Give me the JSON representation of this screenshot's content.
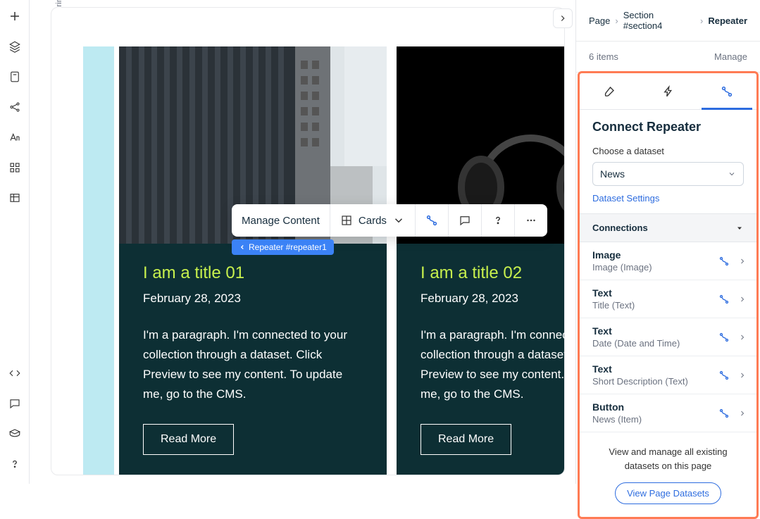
{
  "breakpoint_label": "Desktop (Primary)",
  "breadcrumb": {
    "page": "Page",
    "section": "Section #section4",
    "current": "Repeater"
  },
  "items_count": "6 items",
  "manage_label": "Manage",
  "panel": {
    "title": "Connect Repeater",
    "choose_label": "Choose a dataset",
    "dataset_selected": "News",
    "settings_link": "Dataset Settings",
    "connections_header": "Connections",
    "footer_text": "View and manage all existing datasets on this page",
    "footer_btn": "View Page Datasets"
  },
  "connections": [
    {
      "type": "Image",
      "field": "Image (Image)"
    },
    {
      "type": "Text",
      "field": "Title (Text)"
    },
    {
      "type": "Text",
      "field": "Date (Date and Time)"
    },
    {
      "type": "Text",
      "field": "Short Description (Text)"
    },
    {
      "type": "Button",
      "field": "News (Item)"
    }
  ],
  "toolbar": {
    "manage_content": "Manage Content",
    "layout_label": "Cards"
  },
  "repeater_tag": "Repeater #repeater1",
  "cards": [
    {
      "title": "I am a title 01",
      "date": "February 28, 2023",
      "desc": "I'm a paragraph. I'm connected to your collection through a dataset. Click Preview to see my content. To update me, go to the CMS.",
      "btn": "Read More"
    },
    {
      "title": "I am a title 02",
      "date": "February 28, 2023",
      "desc": "I'm a paragraph. I'm connected to your collection through a dataset. Click Preview to see my content. To update me, go to the CMS.",
      "btn": "Read More"
    }
  ]
}
